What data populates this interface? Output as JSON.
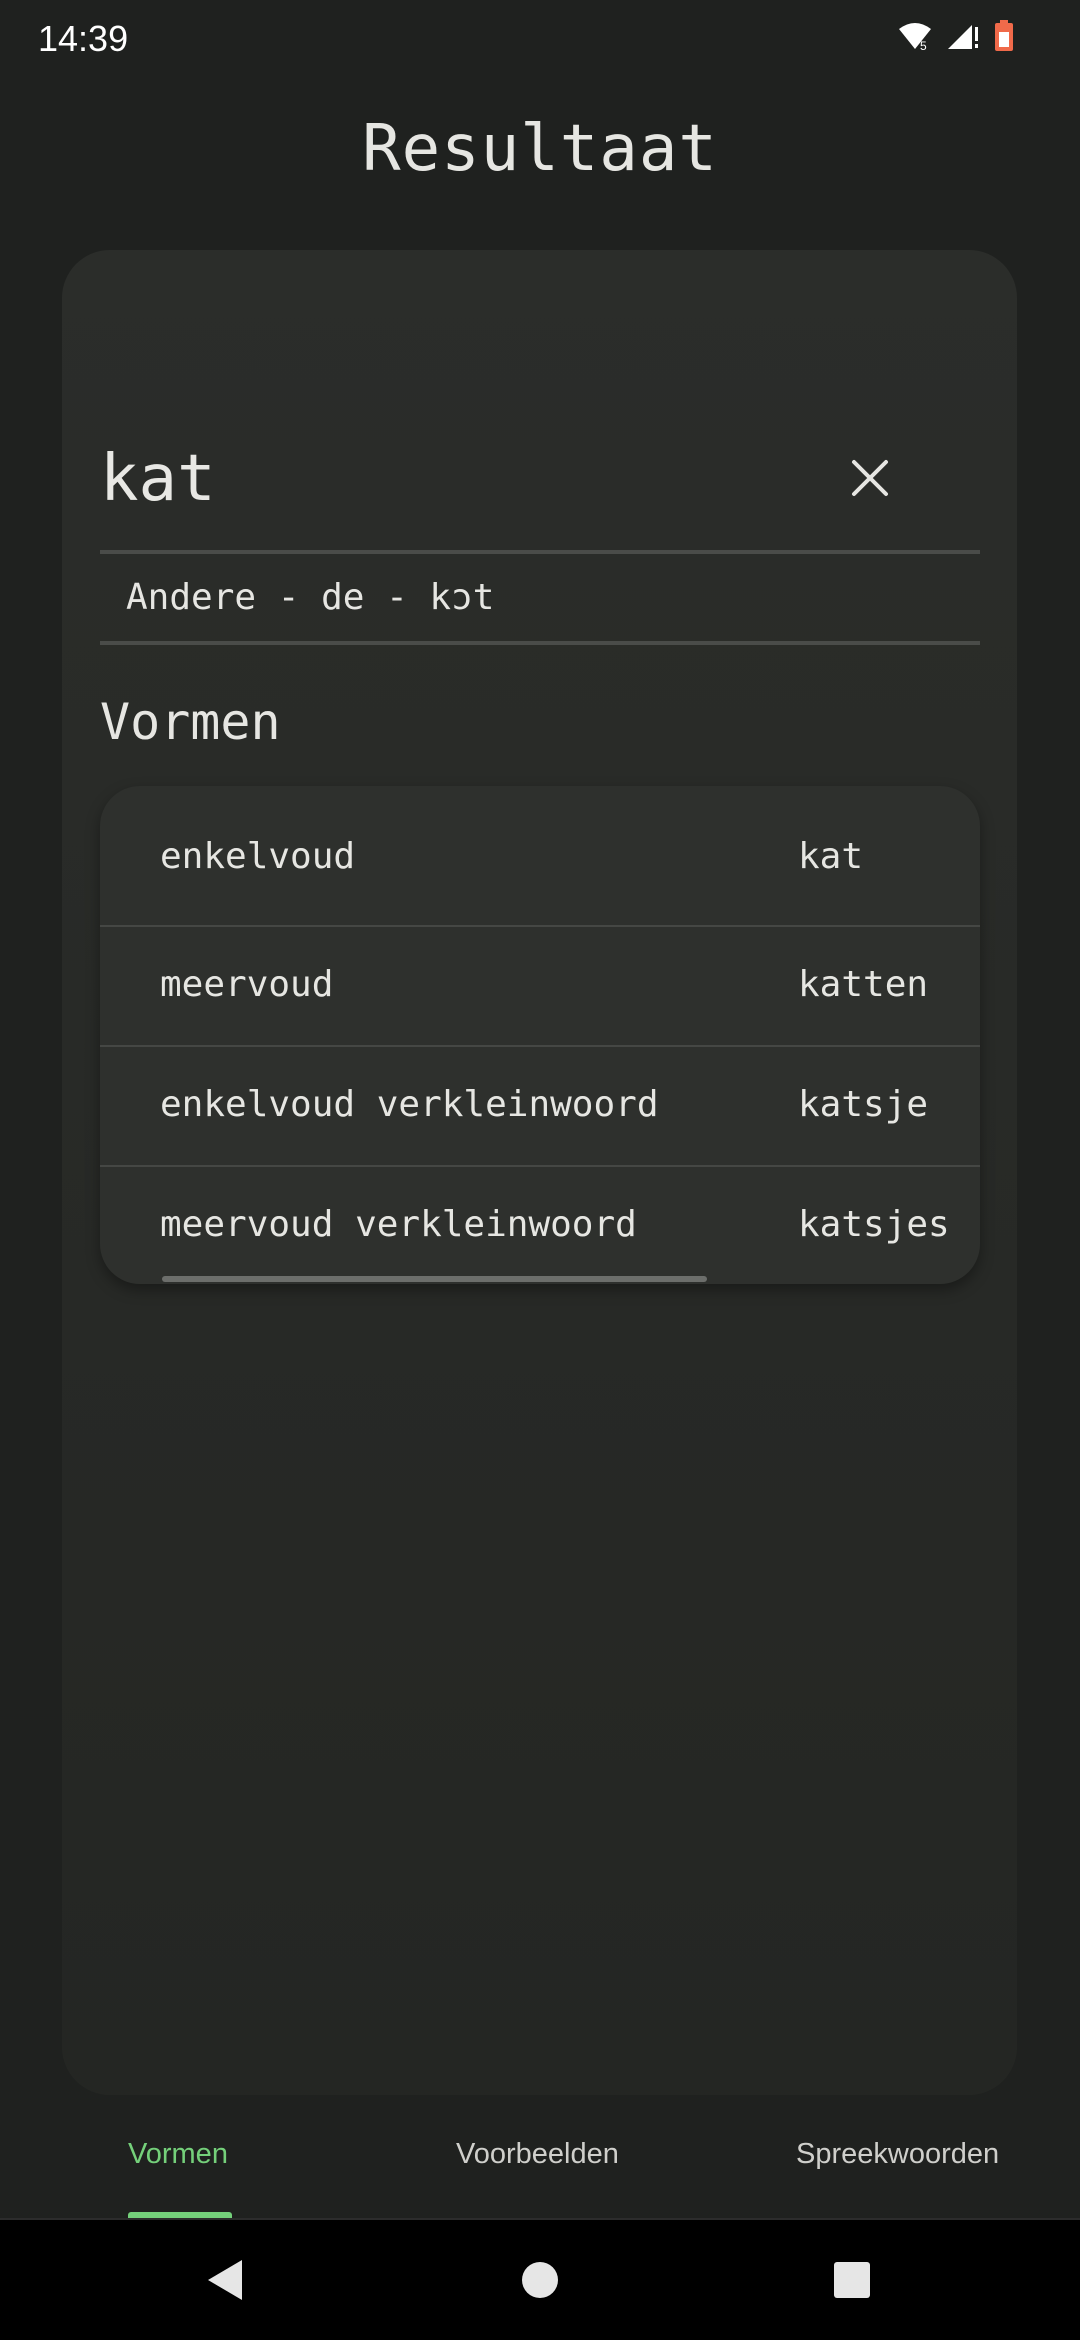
{
  "status_bar": {
    "time": "14:39",
    "icons": [
      "wifi-icon",
      "signal-icon",
      "battery-icon"
    ],
    "battery_color": "#f06a4a"
  },
  "header": {
    "title": "Resultaat"
  },
  "word": {
    "text": "kat",
    "info": "Andere - de - kɔt",
    "clear_icon": "close-icon"
  },
  "forms_section": {
    "title": "Vormen",
    "rows": [
      {
        "label": "enkelvoud",
        "value": "kat"
      },
      {
        "label": "meervoud",
        "value": "katten"
      },
      {
        "label": "enkelvoud verkleinwoord",
        "value": "katsje"
      },
      {
        "label": "meervoud verkleinwoord",
        "value": "katsjes"
      }
    ]
  },
  "tabs": {
    "items": [
      {
        "label": "Vormen",
        "active": true
      },
      {
        "label": "Voorbeelden",
        "active": false
      },
      {
        "label": "Spreekwoorden",
        "active": false
      }
    ],
    "accent_color": "#74d07a"
  },
  "nav": {
    "icons": [
      "back-icon",
      "home-icon",
      "recents-icon"
    ]
  }
}
